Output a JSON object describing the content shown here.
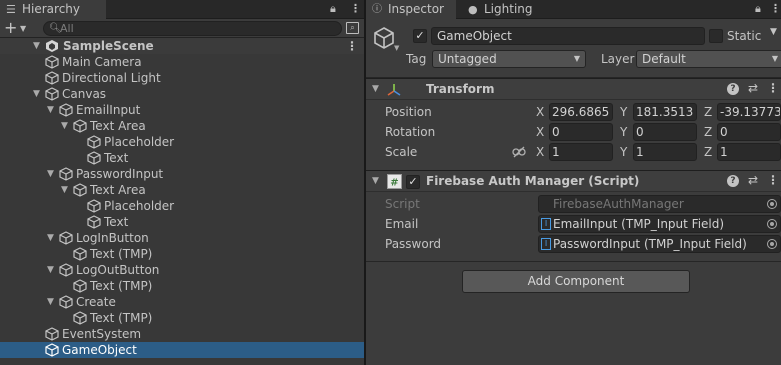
{
  "hierarchy": {
    "tab_label": "Hierarchy",
    "search": {
      "placeholder": "All",
      "value": ""
    },
    "scene": {
      "name": "SampleScene"
    },
    "items": [
      {
        "label": "Main Camera",
        "depth": 1,
        "expanded": null
      },
      {
        "label": "Directional Light",
        "depth": 1,
        "expanded": null
      },
      {
        "label": "Canvas",
        "depth": 1,
        "expanded": true
      },
      {
        "label": "EmailInput",
        "depth": 2,
        "expanded": true
      },
      {
        "label": "Text Area",
        "depth": 3,
        "expanded": true
      },
      {
        "label": "Placeholder",
        "depth": 4,
        "expanded": null
      },
      {
        "label": "Text",
        "depth": 4,
        "expanded": null
      },
      {
        "label": "PasswordInput",
        "depth": 2,
        "expanded": true
      },
      {
        "label": "Text Area",
        "depth": 3,
        "expanded": true
      },
      {
        "label": "Placeholder",
        "depth": 4,
        "expanded": null
      },
      {
        "label": "Text",
        "depth": 4,
        "expanded": null
      },
      {
        "label": "LogInButton",
        "depth": 2,
        "expanded": true
      },
      {
        "label": "Text (TMP)",
        "depth": 3,
        "expanded": null
      },
      {
        "label": "LogOutButton",
        "depth": 2,
        "expanded": true
      },
      {
        "label": "Text (TMP)",
        "depth": 3,
        "expanded": null
      },
      {
        "label": "Create",
        "depth": 2,
        "expanded": true
      },
      {
        "label": "Text (TMP)",
        "depth": 3,
        "expanded": null
      },
      {
        "label": "EventSystem",
        "depth": 1,
        "expanded": null
      },
      {
        "label": "GameObject",
        "depth": 1,
        "expanded": null,
        "selected": true
      }
    ]
  },
  "inspector": {
    "tabs": {
      "inspector": "Inspector",
      "lighting": "Lighting"
    },
    "gameobject": {
      "active": true,
      "name": "GameObject",
      "static_label": "Static",
      "static": false,
      "tag_label": "Tag",
      "tag_value": "Untagged",
      "layer_label": "Layer",
      "layer_value": "Default"
    },
    "transform": {
      "title": "Transform",
      "position_label": "Position",
      "rotation_label": "Rotation",
      "scale_label": "Scale",
      "axes": {
        "x": "X",
        "y": "Y",
        "z": "Z"
      },
      "position": {
        "x": "296.6865",
        "y": "181.3513",
        "z": "-39.13773"
      },
      "rotation": {
        "x": "0",
        "y": "0",
        "z": "0"
      },
      "scale": {
        "x": "1",
        "y": "1",
        "z": "1"
      }
    },
    "script_component": {
      "title": "Firebase Auth Manager (Script)",
      "enabled": true,
      "script_label": "Script",
      "script_value": "FirebaseAuthManager",
      "email_label": "Email",
      "email_value": "EmailInput (TMP_Input Field)",
      "password_label": "Password",
      "password_value": "PasswordInput (TMP_Input Field)"
    },
    "add_component_label": "Add Component"
  },
  "colors": {
    "selection": "#2c5d87",
    "panel_bg": "#383838",
    "inspector_bg": "#3c3c3c",
    "field_bg": "#2a2a2a",
    "accent_icon": "#4a9be2"
  }
}
